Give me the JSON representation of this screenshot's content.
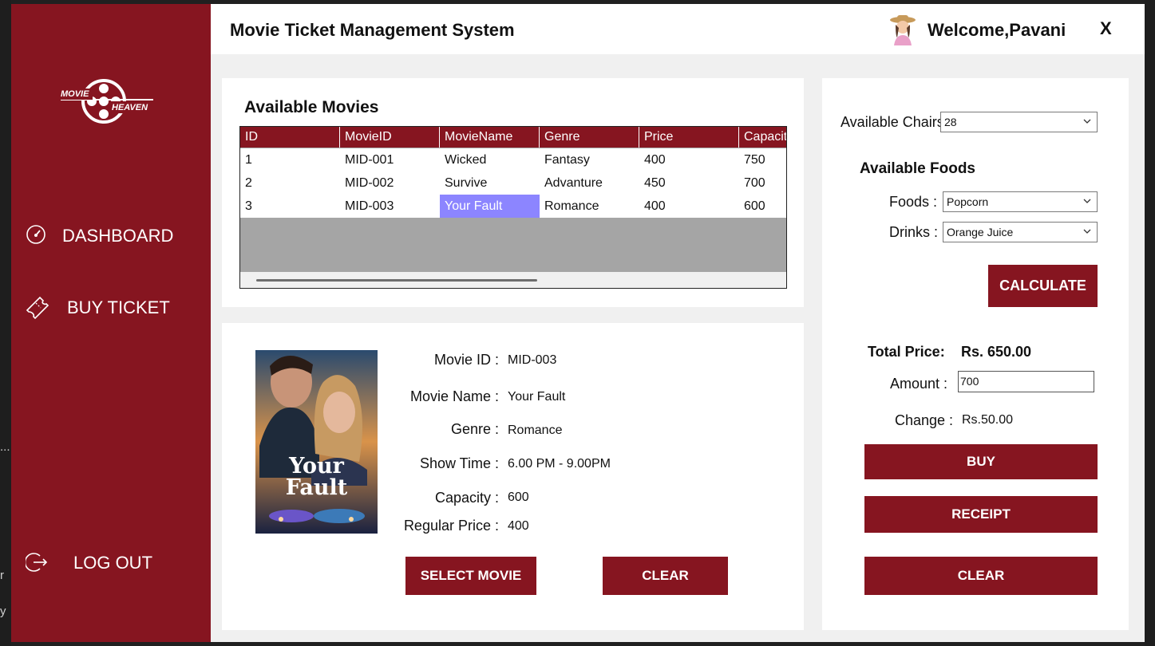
{
  "app": {
    "title": "Movie Ticket Management System",
    "welcome": "Welcome,Pavani",
    "close_label": "X"
  },
  "logo": {
    "top_word": "MOVIE",
    "bottom_word": "HEAVEN"
  },
  "sidebar": {
    "items": [
      {
        "label": "DASHBOARD",
        "icon": "dashboard-gauge-icon"
      },
      {
        "label": "BUY TICKET",
        "icon": "ticket-icon"
      },
      {
        "label": "LOG OUT",
        "icon": "logout-icon"
      }
    ]
  },
  "movies": {
    "title": "Available Movies",
    "columns": [
      "ID",
      "MovieID",
      "MovieName",
      "Genre",
      "Price",
      "Capacity"
    ],
    "rows": [
      [
        "1",
        "MID-001",
        "Wicked",
        "Fantasy",
        "400",
        "750"
      ],
      [
        "2",
        "MID-002",
        "Survive",
        "Advanture",
        "450",
        "700"
      ],
      [
        "3",
        "MID-003",
        "Your Fault",
        "Romance",
        "400",
        "600"
      ]
    ],
    "selected_cell": {
      "row": 2,
      "col": 2
    }
  },
  "poster": {
    "line1": "Your",
    "line2": "Fault"
  },
  "details": {
    "movie_id_label": "Movie ID :",
    "movie_id": "MID-003",
    "movie_name_label": "Movie Name :",
    "movie_name": "Your Fault",
    "genre_label": "Genre :",
    "genre": "Romance",
    "show_time_label": "Show Time :",
    "show_time": "6.00 PM - 9.00PM",
    "capacity_label": "Capacity :",
    "capacity": "600",
    "regular_price_label": "Regular Price :",
    "regular_price": "400",
    "select_button": "SELECT MOVIE",
    "clear_button": "CLEAR"
  },
  "order": {
    "chairs_label": "Available Chairs",
    "chairs_value": "28",
    "foods_title": "Available Foods",
    "foods_label": "Foods :",
    "foods_value": "Popcorn",
    "drinks_label": "Drinks :",
    "drinks_value": "Orange Juice",
    "calculate_button": "CALCULATE",
    "total_label": "Total Price:",
    "total_value": "Rs. 650.00",
    "amount_label": "Amount :",
    "amount_value": "700",
    "change_label": "Change :",
    "change_value": "Rs.50.00",
    "buy_button": "BUY",
    "receipt_button": "RECEIPT",
    "clear_button": "CLEAR"
  },
  "desktop": {
    "glyphs": [
      "...",
      "r",
      "y"
    ]
  },
  "colors": {
    "accent": "#861520",
    "selection": "#8c85ff"
  }
}
